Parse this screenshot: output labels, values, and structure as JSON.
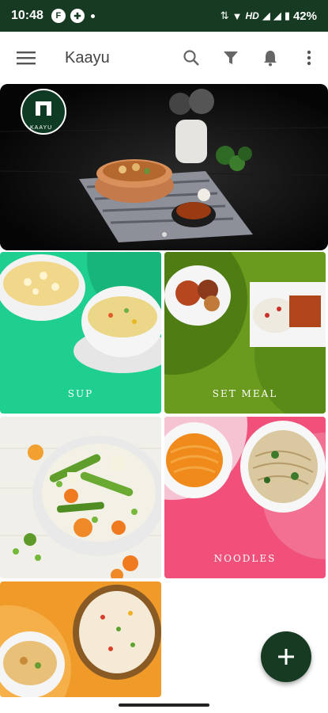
{
  "status_bar": {
    "time": "10:48",
    "network": "HD",
    "battery": "42%"
  },
  "toolbar": {
    "title": "Kaayu"
  },
  "banner": {
    "logo_text": "KAAYU"
  },
  "categories": [
    {
      "label": "SUP"
    },
    {
      "label": "SET MEAL"
    },
    {
      "label": ""
    },
    {
      "label": "NOODLES"
    },
    {
      "label": ""
    }
  ],
  "fab": {
    "icon": "+"
  },
  "colors": {
    "brand_dark": "#173b22",
    "sup_green": "#1fcf8f",
    "set_meal_olive": "#6a9b1f",
    "noodles_pink": "#f0507a",
    "rice_orange": "#f09a2a"
  }
}
